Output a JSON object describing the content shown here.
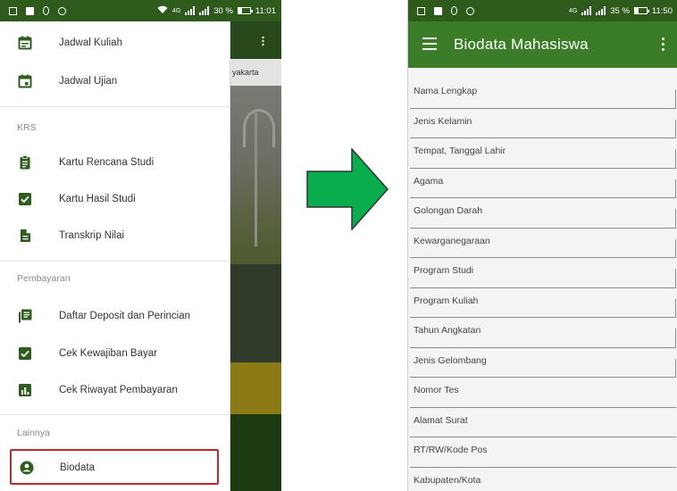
{
  "left_phone": {
    "statusbar": {
      "network": "4G",
      "battery": "30 %",
      "time": "11:01"
    },
    "background_app": {
      "tab_text": "yakarta"
    },
    "drawer": {
      "items_top": [
        {
          "label": "Jadwal Kuliah",
          "icon": "calendar-icon"
        },
        {
          "label": "Jadwal Ujian",
          "icon": "calendar-day-icon"
        }
      ],
      "sections": [
        {
          "title": "KRS",
          "items": [
            {
              "label": "Kartu Rencana Studi",
              "icon": "clipboard-icon"
            },
            {
              "label": "Kartu Hasil Studi",
              "icon": "checkbox-icon"
            },
            {
              "label": "Transkrip Nilai",
              "icon": "document-icon"
            }
          ]
        },
        {
          "title": "Pembayaran",
          "items": [
            {
              "label": "Daftar Deposit dan Perincian",
              "icon": "list-icon"
            },
            {
              "label": "Cek Kewajiban Bayar",
              "icon": "checkbox-icon"
            },
            {
              "label": "Cek Riwayat Pembayaran",
              "icon": "bar-chart-icon"
            }
          ]
        },
        {
          "title": "Lainnya",
          "items": [
            {
              "label": "Biodata",
              "icon": "account-circle-icon"
            }
          ]
        }
      ]
    }
  },
  "right_phone": {
    "statusbar": {
      "network": "4G",
      "battery": "35 %",
      "time": "11:50"
    },
    "appbar": {
      "title": "Biodata Mahasiswa"
    },
    "fields": [
      "Nama Lengkap",
      "Jenis Kelamin",
      "Tempat, Tanggal Lahir",
      "Agama",
      "Golongan Darah",
      "Kewarganegaraan",
      "Program Studi",
      "Program Kuliah",
      "Tahun Angkatan",
      "Jenis Gelombang",
      "Nomor Tes",
      "Alamat Surat",
      "RT/RW/Kode Pos",
      "Kabupaten/Kota"
    ]
  },
  "colors": {
    "primary_green": "#3b7d27",
    "status_green": "#2e5a1c",
    "icon_green": "#2f5d1f",
    "arrow_green": "#0aad4d",
    "highlight_red": "#c0272d"
  }
}
